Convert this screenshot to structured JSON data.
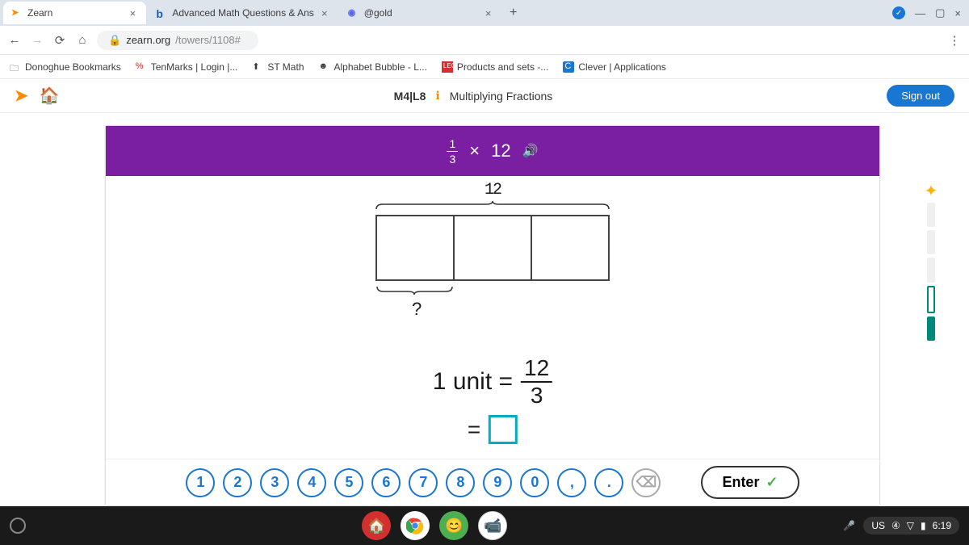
{
  "browser": {
    "tabs": [
      {
        "title": "Zearn",
        "favicon": "➤",
        "active": true
      },
      {
        "title": "Advanced Math Questions & Ans",
        "favicon": "b"
      },
      {
        "title": "@gold",
        "favicon": "⬚"
      }
    ],
    "url_host": "zearn.org",
    "url_path": "/towers/1108#",
    "bookmarks": [
      {
        "label": "Donoghue Bookmarks",
        "icon": "🗀"
      },
      {
        "label": "TenMarks | Login |...",
        "icon": "%"
      },
      {
        "label": "ST Math",
        "icon": "⬆"
      },
      {
        "label": "Alphabet Bubble - L...",
        "icon": "☻"
      },
      {
        "label": "Products and sets -...",
        "icon": "■"
      },
      {
        "label": "Clever | Applications",
        "icon": "C"
      }
    ]
  },
  "app": {
    "lesson_code": "M4|L8",
    "lesson_title": "Multiplying Fractions",
    "sign_out": "Sign out"
  },
  "problem": {
    "frac_num": "1",
    "frac_den": "3",
    "operator": "×",
    "whole": "12",
    "top_label": "12",
    "question_mark": "?",
    "unit_text": "1 unit =",
    "result_num": "12",
    "result_den": "3",
    "equals": "="
  },
  "keypad": {
    "keys": [
      "1",
      "2",
      "3",
      "4",
      "5",
      "6",
      "7",
      "8",
      "9",
      "0",
      ",",
      "."
    ],
    "backspace": "⌫",
    "enter": "Enter"
  },
  "shelf": {
    "lang": "US",
    "time": "6:19"
  }
}
